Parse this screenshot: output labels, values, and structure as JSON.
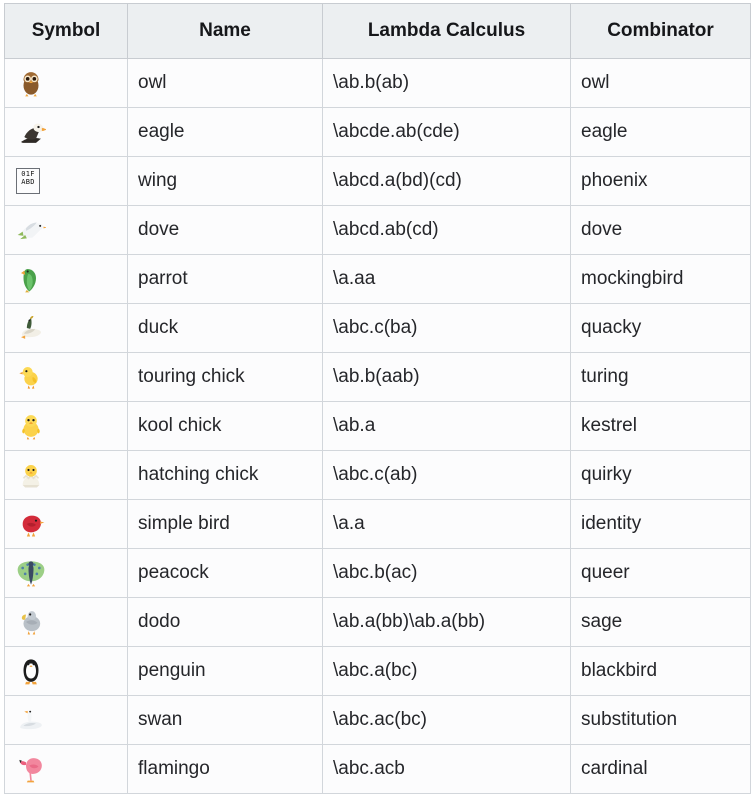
{
  "table": {
    "name": "bird-combinators-table",
    "columns": [
      {
        "key": "symbol",
        "label": "Symbol"
      },
      {
        "key": "name",
        "label": "Name"
      },
      {
        "key": "lambda",
        "label": "Lambda Calculus"
      },
      {
        "key": "combinator",
        "label": "Combinator"
      }
    ],
    "rows": [
      {
        "symbol_icon": "owl-emoji",
        "name": "owl",
        "lambda": "\\ab.b(ab)",
        "combinator": "owl"
      },
      {
        "symbol_icon": "eagle-emoji",
        "name": "eagle",
        "lambda": "\\abcde.ab(cde)",
        "combinator": "eagle"
      },
      {
        "symbol_icon": "wing-missing-glyph",
        "name": "wing",
        "lambda": "\\abcd.a(bd)(cd)",
        "combinator": "phoenix",
        "missing_glyph_code_top": "01F",
        "missing_glyph_code_bottom": "ABD"
      },
      {
        "symbol_icon": "dove-emoji",
        "name": "dove",
        "lambda": "\\abcd.ab(cd)",
        "combinator": "dove"
      },
      {
        "symbol_icon": "parrot-emoji",
        "name": "parrot",
        "lambda": "\\a.aa",
        "combinator": "mockingbird"
      },
      {
        "symbol_icon": "duck-emoji",
        "name": "duck",
        "lambda": "\\abc.c(ba)",
        "combinator": "quacky"
      },
      {
        "symbol_icon": "baby-chick-emoji",
        "name": "touring chick",
        "lambda": "\\ab.b(aab)",
        "combinator": "turing"
      },
      {
        "symbol_icon": "front-facing-baby-chick-emoji",
        "name": "kool chick",
        "lambda": "\\ab.a",
        "combinator": "kestrel"
      },
      {
        "symbol_icon": "hatching-chick-emoji",
        "name": "hatching chick",
        "lambda": "\\abc.c(ab)",
        "combinator": "quirky"
      },
      {
        "symbol_icon": "bird-emoji",
        "name": "simple bird",
        "lambda": "\\a.a",
        "combinator": "identity"
      },
      {
        "symbol_icon": "peacock-emoji",
        "name": "peacock",
        "lambda": "\\abc.b(ac)",
        "combinator": "queer"
      },
      {
        "symbol_icon": "dodo-emoji",
        "name": "dodo",
        "lambda": "\\ab.a(bb)\\ab.a(bb)",
        "combinator": "sage"
      },
      {
        "symbol_icon": "penguin-emoji",
        "name": "penguin",
        "lambda": "\\abc.a(bc)",
        "combinator": "blackbird"
      },
      {
        "symbol_icon": "swan-emoji",
        "name": "swan",
        "lambda": "\\abc.ac(bc)",
        "combinator": "substitution"
      },
      {
        "symbol_icon": "flamingo-emoji",
        "name": "flamingo",
        "lambda": "\\abc.acb",
        "combinator": "cardinal"
      }
    ]
  },
  "colors": {
    "header_background": "#eceff1",
    "header_text": "#16171a",
    "cell_background": "#fcfcfd",
    "cell_text": "#25262a",
    "border": "#d2d6db",
    "outer_border": "#c8ccd1",
    "page_background": "#ffffff"
  }
}
